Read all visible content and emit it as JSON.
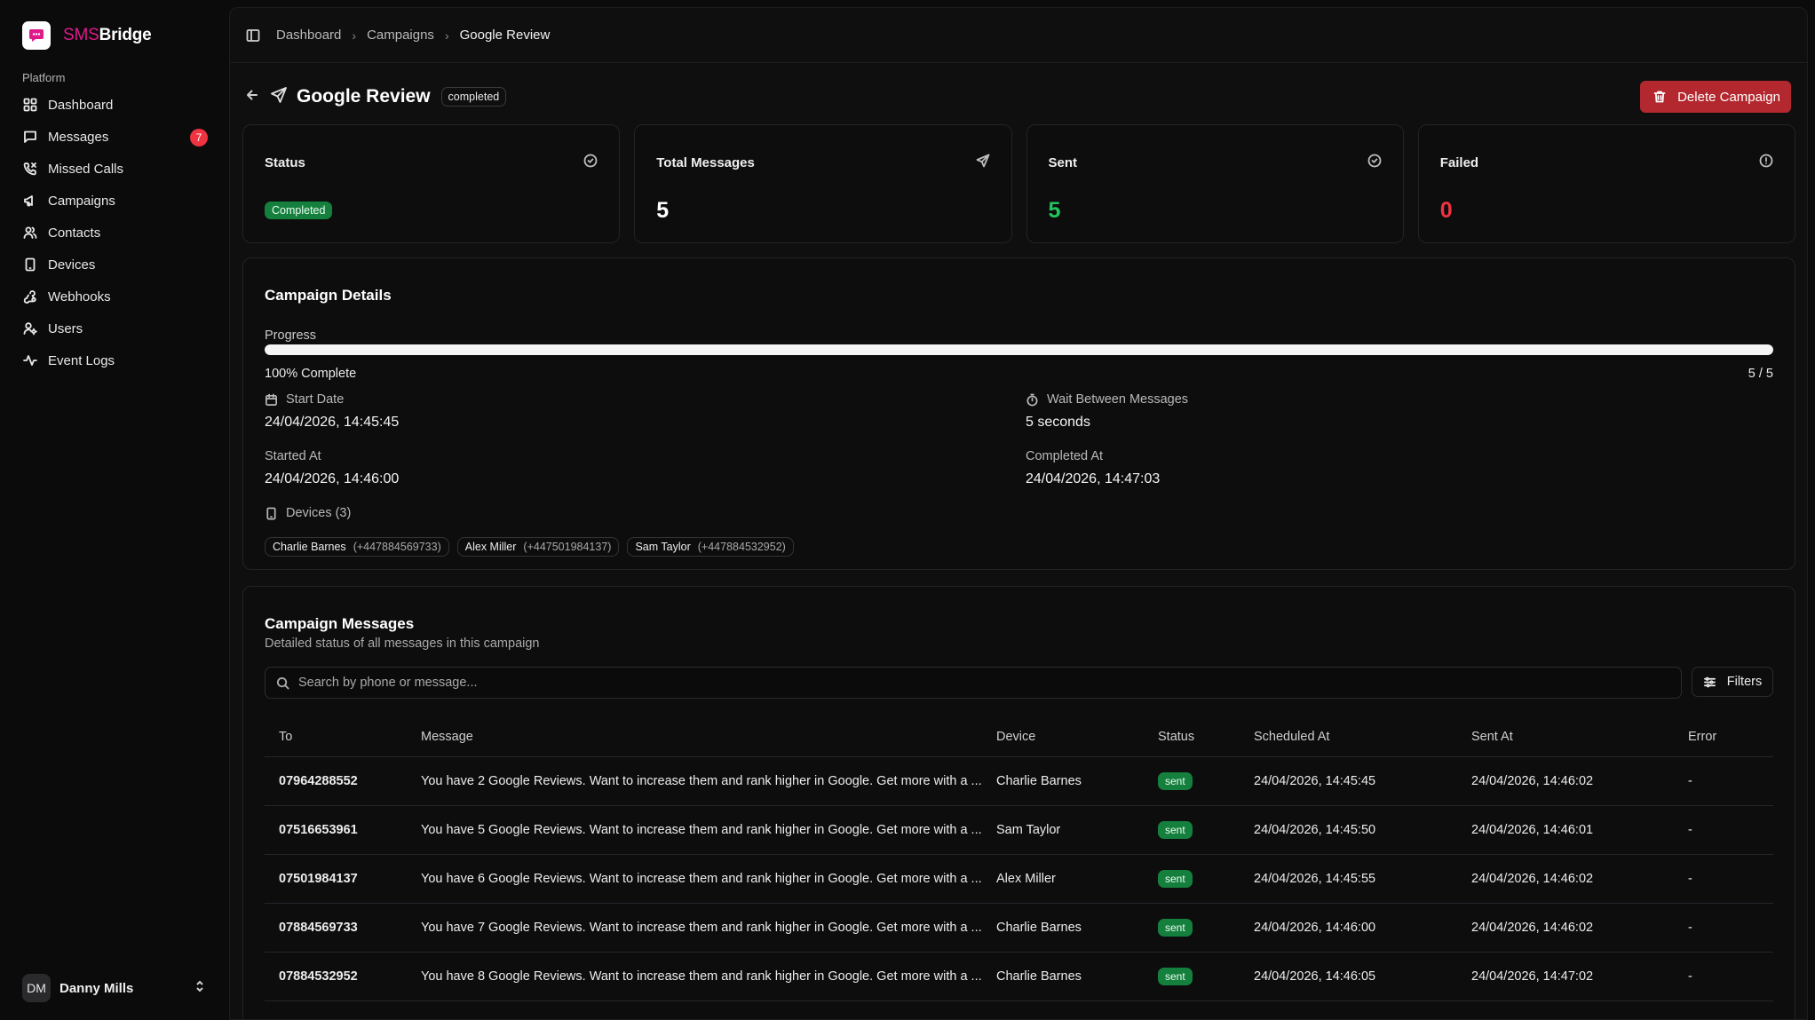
{
  "brand": {
    "sms": "SMS",
    "bridge": "Bridge"
  },
  "sidebar": {
    "section_label": "Platform",
    "items": [
      {
        "label": "Dashboard",
        "icon": "grid-icon"
      },
      {
        "label": "Messages",
        "icon": "message-square-icon",
        "badge": "7"
      },
      {
        "label": "Missed Calls",
        "icon": "phone-missed-icon"
      },
      {
        "label": "Campaigns",
        "icon": "megaphone-icon"
      },
      {
        "label": "Contacts",
        "icon": "users-icon"
      },
      {
        "label": "Devices",
        "icon": "smartphone-icon"
      },
      {
        "label": "Webhooks",
        "icon": "webhook-icon"
      },
      {
        "label": "Users",
        "icon": "user-cog-icon"
      },
      {
        "label": "Event Logs",
        "icon": "activity-icon"
      }
    ],
    "user": {
      "initials": "DM",
      "name": "Danny Mills"
    }
  },
  "breadcrumb": [
    "Dashboard",
    "Campaigns",
    "Google Review"
  ],
  "header": {
    "title": "Google Review",
    "status": "completed",
    "delete_label": "Delete Campaign"
  },
  "stats": [
    {
      "label": "Status",
      "badge": "Completed",
      "icon": "circle-check-icon"
    },
    {
      "label": "Total Messages",
      "value": "5",
      "icon": "send-icon"
    },
    {
      "label": "Sent",
      "value": "5",
      "icon": "circle-check-icon",
      "color": "#22c55e"
    },
    {
      "label": "Failed",
      "value": "0",
      "icon": "alert-circle-icon",
      "color": "#ef3340"
    }
  ],
  "details": {
    "title": "Campaign Details",
    "progress_label": "Progress",
    "progress_fraction": 1.0,
    "progress_text": "100% Complete",
    "progress_count": "5 / 5",
    "start_date_label": "Start Date",
    "start_date": "24/04/2026, 14:45:45",
    "wait_label": "Wait Between Messages",
    "wait_value": "5 seconds",
    "started_at_label": "Started At",
    "started_at": "24/04/2026, 14:46:00",
    "completed_at_label": "Completed At",
    "completed_at": "24/04/2026, 14:47:03",
    "devices_label": "Devices (3)",
    "devices": [
      {
        "name": "Charlie Barnes",
        "phone": "(+447884569733)"
      },
      {
        "name": "Alex Miller",
        "phone": "(+447501984137)"
      },
      {
        "name": "Sam Taylor",
        "phone": "(+447884532952)"
      }
    ]
  },
  "messages": {
    "title": "Campaign Messages",
    "subtitle": "Detailed status of all messages in this campaign",
    "search_placeholder": "Search by phone or message...",
    "filters_label": "Filters",
    "columns": [
      "To",
      "Message",
      "Device",
      "Status",
      "Scheduled At",
      "Sent At",
      "Error"
    ],
    "rows": [
      {
        "to": "07964288552",
        "message": "You have 2 Google Reviews. Want to increase them and rank higher in Google. Get more with a ...",
        "device": "Charlie Barnes",
        "status": "sent",
        "scheduled": "24/04/2026, 14:45:45",
        "sent": "24/04/2026, 14:46:02",
        "error": "-"
      },
      {
        "to": "07516653961",
        "message": "You have 5 Google Reviews. Want to increase them and rank higher in Google. Get more with a ...",
        "device": "Sam Taylor",
        "status": "sent",
        "scheduled": "24/04/2026, 14:45:50",
        "sent": "24/04/2026, 14:46:01",
        "error": "-"
      },
      {
        "to": "07501984137",
        "message": "You have 6 Google Reviews. Want to increase them and rank higher in Google. Get more with a ...",
        "device": "Alex Miller",
        "status": "sent",
        "scheduled": "24/04/2026, 14:45:55",
        "sent": "24/04/2026, 14:46:02",
        "error": "-"
      },
      {
        "to": "07884569733",
        "message": "You have 7 Google Reviews. Want to increase them and rank higher in Google. Get more with a ...",
        "device": "Charlie Barnes",
        "status": "sent",
        "scheduled": "24/04/2026, 14:46:00",
        "sent": "24/04/2026, 14:46:02",
        "error": "-"
      },
      {
        "to": "07884532952",
        "message": "You have 8 Google Reviews. Want to increase them and rank higher in Google. Get more with a ...",
        "device": "Charlie Barnes",
        "status": "sent",
        "scheduled": "24/04/2026, 14:46:05",
        "sent": "24/04/2026, 14:47:02",
        "error": "-"
      }
    ]
  }
}
